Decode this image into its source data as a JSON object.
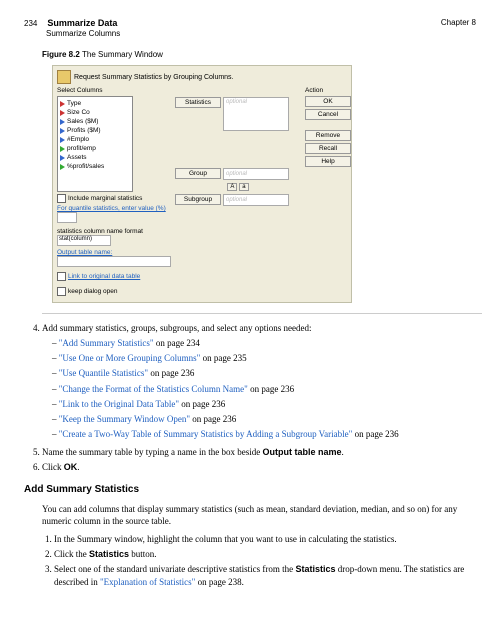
{
  "header": {
    "page_num": "234",
    "title": "Summarize Data",
    "subtitle": "Summarize Columns",
    "chapter": "Chapter 8"
  },
  "figure": {
    "label": "Figure 8.2",
    "caption": "The Summary Window"
  },
  "dialog": {
    "title": "Request Summary Statistics by Grouping Columns.",
    "select_label": "Select Columns",
    "columns": [
      "Type",
      "Size Co",
      "Sales ($M)",
      "Profits ($M)",
      "#Emplo",
      "profit/emp",
      "Assets",
      "%profit/sales"
    ],
    "stats_btn": "Statistics",
    "group_btn": "Group",
    "subgroup_btn": "Subgroup",
    "optional": "optional",
    "action_label": "Action",
    "actions": {
      "ok": "OK",
      "cancel": "Cancel",
      "remove": "Remove",
      "recall": "Recall",
      "help": "Help"
    },
    "include_marginal": "Include marginal statistics",
    "quantile_label": "For quantile statistics, enter value (%)",
    "col_fmt_label": "statistics column name format",
    "col_fmt_value": "stat(column)",
    "out_tbl_label": "Output table name:",
    "link_orig": "Link to original data table",
    "keep_open": "keep dialog open",
    "ab": {
      "a": "A",
      "b": "a"
    }
  },
  "steps": {
    "s4": "Add summary statistics, groups, subgroups, and select any options needed:",
    "links": [
      {
        "text": "\"Add Summary Statistics\"",
        "tail": " on page 234"
      },
      {
        "text": "\"Use One or More Grouping Columns\"",
        "tail": " on page 235"
      },
      {
        "text": "\"Use Quantile Statistics\"",
        "tail": " on page 236"
      },
      {
        "text": "\"Change the Format of the Statistics Column Name\"",
        "tail": " on page 236"
      },
      {
        "text": "\"Link to the Original Data Table\"",
        "tail": " on page 236"
      },
      {
        "text": "\"Keep the Summary Window Open\"",
        "tail": " on page 236"
      },
      {
        "text": "\"Create a Two-Way Table of Summary Statistics by Adding a Subgroup Variable\"",
        "tail": " on page 236"
      }
    ],
    "s5_pre": "Name the summary table by typing a name in the box beside ",
    "s5_bold": "Output table name",
    "s5_post": ".",
    "s6_pre": "Click ",
    "s6_bold": "OK",
    "s6_post": "."
  },
  "section": {
    "title": "Add Summary Statistics",
    "intro": "You can add columns that display summary statistics (such as mean, standard deviation, median, and so on) for any numeric column in the source table.",
    "n1": "In the Summary window, highlight the column that you want to use in calculating the statistics.",
    "n2_pre": "Click the ",
    "n2_bold": "Statistics",
    "n2_post": " button.",
    "n3_pre": "Select one of the standard univariate descriptive statistics from the ",
    "n3_bold": "Statistics",
    "n3_mid": " drop-down menu. The statistics are described in ",
    "n3_link": "\"Explanation of Statistics\"",
    "n3_tail": " on page 238."
  }
}
